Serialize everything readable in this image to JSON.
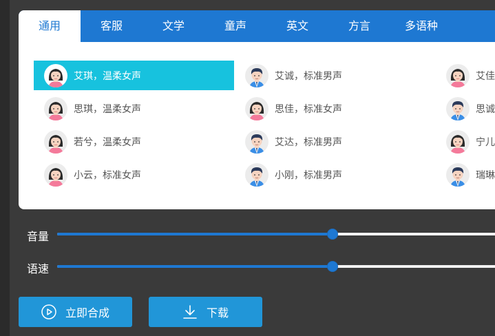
{
  "tabs": [
    {
      "label": "通用",
      "active": true
    },
    {
      "label": "客服",
      "active": false
    },
    {
      "label": "文学",
      "active": false
    },
    {
      "label": "童声",
      "active": false
    },
    {
      "label": "英文",
      "active": false
    },
    {
      "label": "方言",
      "active": false
    },
    {
      "label": "多语种",
      "active": false
    }
  ],
  "voices": [
    {
      "label": "艾琪，温柔女声",
      "gender": "female",
      "selected": true
    },
    {
      "label": "艾诚，标准男声",
      "gender": "male",
      "selected": false
    },
    {
      "label": "艾佳",
      "gender": "female",
      "selected": false
    },
    {
      "label": "思琪，温柔女声",
      "gender": "female",
      "selected": false
    },
    {
      "label": "思佳，标准女声",
      "gender": "female",
      "selected": false
    },
    {
      "label": "思诚",
      "gender": "male",
      "selected": false
    },
    {
      "label": "若兮，温柔女声",
      "gender": "female",
      "selected": false
    },
    {
      "label": "艾达，标准男声",
      "gender": "male",
      "selected": false
    },
    {
      "label": "宁儿",
      "gender": "female",
      "selected": false
    },
    {
      "label": "小云，标准女声",
      "gender": "female",
      "selected": false
    },
    {
      "label": "小刚，标准男声",
      "gender": "male",
      "selected": false
    },
    {
      "label": "瑞琳",
      "gender": "male",
      "selected": false
    }
  ],
  "sliders": {
    "volume": {
      "label": "音量",
      "value": 0.625
    },
    "speed": {
      "label": "语速",
      "value": 0.625
    }
  },
  "buttons": {
    "synthesize": {
      "label": "立即合成",
      "icon": "play-circle-icon"
    },
    "download": {
      "label": "下载",
      "icon": "download-icon"
    }
  },
  "colors": {
    "tab_bar": "#1e78d2",
    "selected": "#17c2de",
    "button": "#2196d8",
    "slider_fill": "#1e78d2"
  }
}
